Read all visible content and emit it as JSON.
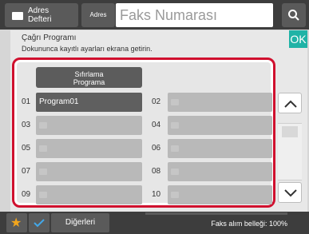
{
  "header": {
    "address_book_label": "Adres\nDefteri",
    "address_button_label": "Adres",
    "fax_placeholder": "Faks Numarası"
  },
  "panel": {
    "title": "Çağrı Programı",
    "subtitle": "Dokununca kayıtlı ayarları ekrana getirin.",
    "ok_label": "OK",
    "reset_label": "Sıfırlama\nPrograma"
  },
  "programs": [
    {
      "num": "01",
      "name": "Program01"
    },
    {
      "num": "02",
      "name": ""
    },
    {
      "num": "03",
      "name": ""
    },
    {
      "num": "04",
      "name": ""
    },
    {
      "num": "05",
      "name": ""
    },
    {
      "num": "06",
      "name": ""
    },
    {
      "num": "07",
      "name": ""
    },
    {
      "num": "08",
      "name": ""
    },
    {
      "num": "09",
      "name": ""
    },
    {
      "num": "10",
      "name": ""
    }
  ],
  "footer": {
    "others_label": "Diğerleri",
    "fax_memory_label": "Faks alım belleği:",
    "fax_memory_value": "100%"
  },
  "colors": {
    "accent_ok": "#1fb3a6",
    "highlight_frame": "#d0102e",
    "star": "#f2a51c",
    "check": "#43a7e8"
  }
}
